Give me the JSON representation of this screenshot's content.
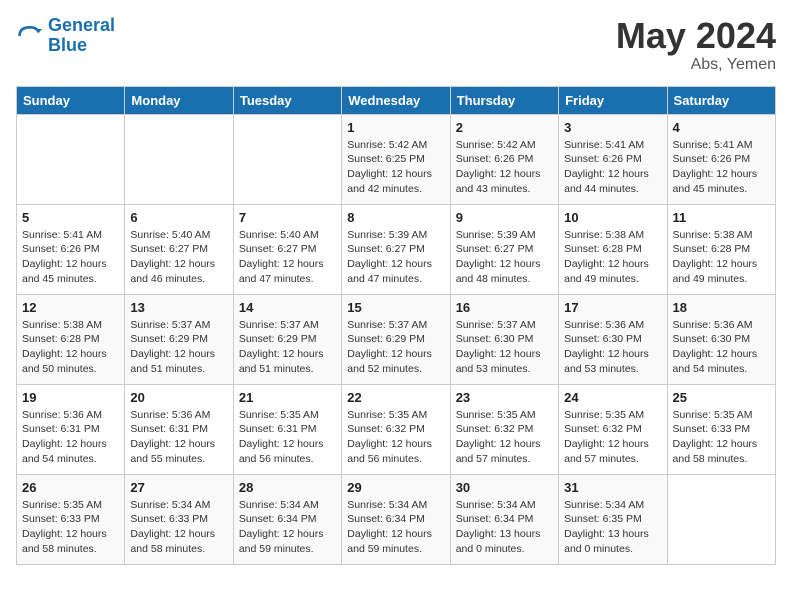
{
  "logo": {
    "line1": "General",
    "line2": "Blue"
  },
  "title": "May 2024",
  "location": "Abs, Yemen",
  "days_header": [
    "Sunday",
    "Monday",
    "Tuesday",
    "Wednesday",
    "Thursday",
    "Friday",
    "Saturday"
  ],
  "weeks": [
    [
      {
        "num": "",
        "info": ""
      },
      {
        "num": "",
        "info": ""
      },
      {
        "num": "",
        "info": ""
      },
      {
        "num": "1",
        "info": "Sunrise: 5:42 AM\nSunset: 6:25 PM\nDaylight: 12 hours\nand 42 minutes."
      },
      {
        "num": "2",
        "info": "Sunrise: 5:42 AM\nSunset: 6:26 PM\nDaylight: 12 hours\nand 43 minutes."
      },
      {
        "num": "3",
        "info": "Sunrise: 5:41 AM\nSunset: 6:26 PM\nDaylight: 12 hours\nand 44 minutes."
      },
      {
        "num": "4",
        "info": "Sunrise: 5:41 AM\nSunset: 6:26 PM\nDaylight: 12 hours\nand 45 minutes."
      }
    ],
    [
      {
        "num": "5",
        "info": "Sunrise: 5:41 AM\nSunset: 6:26 PM\nDaylight: 12 hours\nand 45 minutes."
      },
      {
        "num": "6",
        "info": "Sunrise: 5:40 AM\nSunset: 6:27 PM\nDaylight: 12 hours\nand 46 minutes."
      },
      {
        "num": "7",
        "info": "Sunrise: 5:40 AM\nSunset: 6:27 PM\nDaylight: 12 hours\nand 47 minutes."
      },
      {
        "num": "8",
        "info": "Sunrise: 5:39 AM\nSunset: 6:27 PM\nDaylight: 12 hours\nand 47 minutes."
      },
      {
        "num": "9",
        "info": "Sunrise: 5:39 AM\nSunset: 6:27 PM\nDaylight: 12 hours\nand 48 minutes."
      },
      {
        "num": "10",
        "info": "Sunrise: 5:38 AM\nSunset: 6:28 PM\nDaylight: 12 hours\nand 49 minutes."
      },
      {
        "num": "11",
        "info": "Sunrise: 5:38 AM\nSunset: 6:28 PM\nDaylight: 12 hours\nand 49 minutes."
      }
    ],
    [
      {
        "num": "12",
        "info": "Sunrise: 5:38 AM\nSunset: 6:28 PM\nDaylight: 12 hours\nand 50 minutes."
      },
      {
        "num": "13",
        "info": "Sunrise: 5:37 AM\nSunset: 6:29 PM\nDaylight: 12 hours\nand 51 minutes."
      },
      {
        "num": "14",
        "info": "Sunrise: 5:37 AM\nSunset: 6:29 PM\nDaylight: 12 hours\nand 51 minutes."
      },
      {
        "num": "15",
        "info": "Sunrise: 5:37 AM\nSunset: 6:29 PM\nDaylight: 12 hours\nand 52 minutes."
      },
      {
        "num": "16",
        "info": "Sunrise: 5:37 AM\nSunset: 6:30 PM\nDaylight: 12 hours\nand 53 minutes."
      },
      {
        "num": "17",
        "info": "Sunrise: 5:36 AM\nSunset: 6:30 PM\nDaylight: 12 hours\nand 53 minutes."
      },
      {
        "num": "18",
        "info": "Sunrise: 5:36 AM\nSunset: 6:30 PM\nDaylight: 12 hours\nand 54 minutes."
      }
    ],
    [
      {
        "num": "19",
        "info": "Sunrise: 5:36 AM\nSunset: 6:31 PM\nDaylight: 12 hours\nand 54 minutes."
      },
      {
        "num": "20",
        "info": "Sunrise: 5:36 AM\nSunset: 6:31 PM\nDaylight: 12 hours\nand 55 minutes."
      },
      {
        "num": "21",
        "info": "Sunrise: 5:35 AM\nSunset: 6:31 PM\nDaylight: 12 hours\nand 56 minutes."
      },
      {
        "num": "22",
        "info": "Sunrise: 5:35 AM\nSunset: 6:32 PM\nDaylight: 12 hours\nand 56 minutes."
      },
      {
        "num": "23",
        "info": "Sunrise: 5:35 AM\nSunset: 6:32 PM\nDaylight: 12 hours\nand 57 minutes."
      },
      {
        "num": "24",
        "info": "Sunrise: 5:35 AM\nSunset: 6:32 PM\nDaylight: 12 hours\nand 57 minutes."
      },
      {
        "num": "25",
        "info": "Sunrise: 5:35 AM\nSunset: 6:33 PM\nDaylight: 12 hours\nand 58 minutes."
      }
    ],
    [
      {
        "num": "26",
        "info": "Sunrise: 5:35 AM\nSunset: 6:33 PM\nDaylight: 12 hours\nand 58 minutes."
      },
      {
        "num": "27",
        "info": "Sunrise: 5:34 AM\nSunset: 6:33 PM\nDaylight: 12 hours\nand 58 minutes."
      },
      {
        "num": "28",
        "info": "Sunrise: 5:34 AM\nSunset: 6:34 PM\nDaylight: 12 hours\nand 59 minutes."
      },
      {
        "num": "29",
        "info": "Sunrise: 5:34 AM\nSunset: 6:34 PM\nDaylight: 12 hours\nand 59 minutes."
      },
      {
        "num": "30",
        "info": "Sunrise: 5:34 AM\nSunset: 6:34 PM\nDaylight: 13 hours\nand 0 minutes."
      },
      {
        "num": "31",
        "info": "Sunrise: 5:34 AM\nSunset: 6:35 PM\nDaylight: 13 hours\nand 0 minutes."
      },
      {
        "num": "",
        "info": ""
      }
    ]
  ]
}
